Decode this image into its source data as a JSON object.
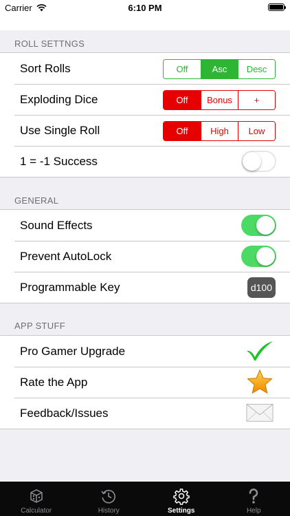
{
  "status_bar": {
    "carrier": "Carrier",
    "time": "6:10 PM"
  },
  "sections": {
    "roll": {
      "header": "ROLL SETTNGS",
      "sort_rolls": {
        "label": "Sort Rolls",
        "options": [
          "Off",
          "Asc",
          "Desc"
        ],
        "selected": "Asc"
      },
      "exploding_dice": {
        "label": "Exploding Dice",
        "options": [
          "Off",
          "Bonus",
          "+"
        ],
        "selected": "Off"
      },
      "single_roll": {
        "label": "Use Single Roll",
        "options": [
          "Off",
          "High",
          "Low"
        ],
        "selected": "Off"
      },
      "success": {
        "label": "1 = -1 Success",
        "toggle_on": false
      }
    },
    "general": {
      "header": "GENERAL",
      "sound": {
        "label": "Sound Effects",
        "toggle_on": true
      },
      "autolock": {
        "label": "Prevent AutoLock",
        "toggle_on": true
      },
      "prog_key": {
        "label": "Programmable Key",
        "value": "d100"
      }
    },
    "app": {
      "header": "APP STUFF",
      "upgrade": {
        "label": "Pro Gamer Upgrade",
        "icon": "checkmark-icon"
      },
      "rate": {
        "label": "Rate the App",
        "icon": "star-icon"
      },
      "feedback": {
        "label": "Feedback/Issues",
        "icon": "envelope-icon"
      }
    }
  },
  "tabs": [
    {
      "label": "Calculator",
      "icon": "dice-icon",
      "active": false
    },
    {
      "label": "History",
      "icon": "history-icon",
      "active": false
    },
    {
      "label": "Settings",
      "icon": "gear-icon",
      "active": true
    },
    {
      "label": "Help",
      "icon": "question-icon",
      "active": false
    }
  ],
  "colors": {
    "green": "#2db533",
    "red": "#e60000",
    "toggle_on": "#4cd964",
    "background": "#efeff4"
  }
}
